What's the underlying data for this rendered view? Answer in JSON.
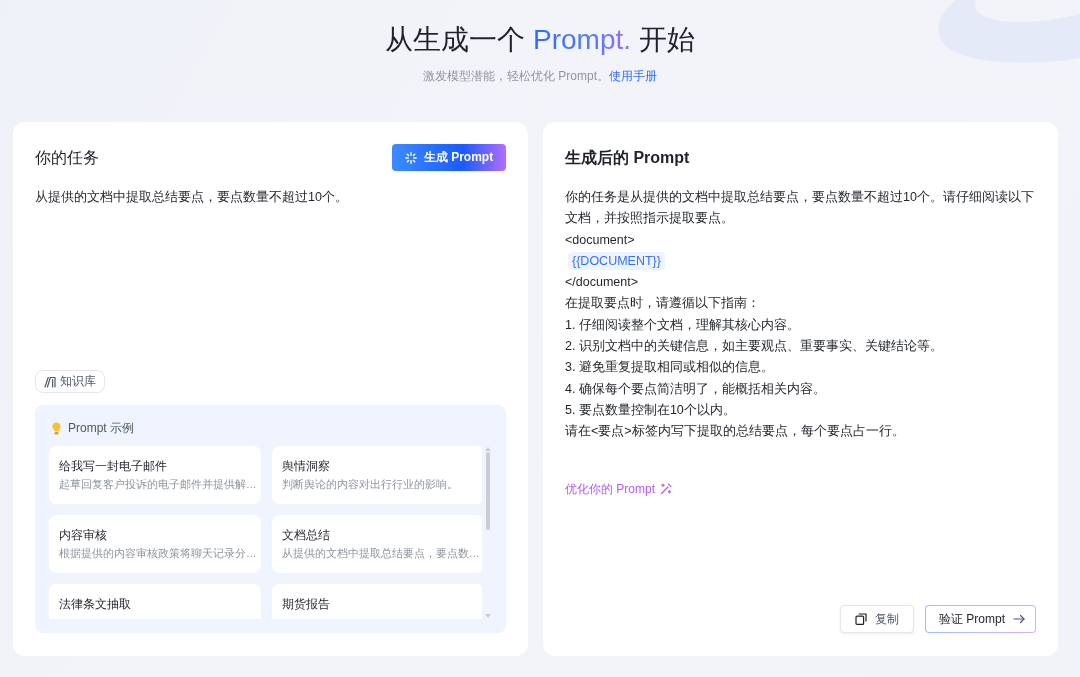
{
  "header": {
    "title": {
      "lead": "从生成一个",
      "accent": "Prompt.",
      "tail": "开始"
    },
    "subtitle": "激发模型潜能，轻松优化 Prompt。",
    "manual_link": "使用手册"
  },
  "task_panel": {
    "title": "你的任务",
    "generate_button": "生成 Prompt",
    "task_input": {
      "value": "从提供的文档中提取总结要点，要点数量不超过10个。"
    },
    "knowledge_button": "知识库",
    "examples": {
      "title": "Prompt 示例",
      "items": [
        {
          "title": "给我写一封电子邮件",
          "description": "起草回复客户投诉的电子邮件并提供解…"
        },
        {
          "title": "舆情洞察",
          "description": "判断舆论的内容对出行行业的影响。"
        },
        {
          "title": "内容审核",
          "description": "根据提供的内容审核政策将聊天记录分…"
        },
        {
          "title": "文档总结",
          "description": "从提供的文档中提取总结要点，要点数…"
        },
        {
          "title": "法律条文抽取"
        },
        {
          "title": "期货报告"
        }
      ]
    }
  },
  "result_panel": {
    "title": "生成后的 Prompt",
    "lines": [
      {
        "kind": "text",
        "text": "你的任务是从提供的文档中提取总结要点，要点数量不超过10个。请仔细阅读以下文档，并按照指示提取要点。"
      },
      {
        "kind": "text",
        "text": "<document>"
      },
      {
        "kind": "variable",
        "text": "{{DOCUMENT}}"
      },
      {
        "kind": "text",
        "text": "</document>"
      },
      {
        "kind": "text",
        "text": "在提取要点时，请遵循以下指南："
      },
      {
        "kind": "text",
        "text": "1. 仔细阅读整个文档，理解其核心内容。"
      },
      {
        "kind": "text",
        "text": "2. 识别文档中的关键信息，如主要观点、重要事实、关键结论等。"
      },
      {
        "kind": "text",
        "text": "3. 避免重复提取相同或相似的信息。"
      },
      {
        "kind": "text",
        "text": "4. 确保每个要点简洁明了，能概括相关内容。"
      },
      {
        "kind": "text",
        "text": "5. 要点数量控制在10个以内。"
      },
      {
        "kind": "text",
        "text": "请在<要点>标签内写下提取的总结要点，每个要点占一行。"
      }
    ],
    "optimize_link": "优化你的 Prompt",
    "buttons": [
      {
        "kind": "copy",
        "label": "复制"
      },
      {
        "kind": "verify",
        "label": "验证 Prompt"
      }
    ]
  }
}
